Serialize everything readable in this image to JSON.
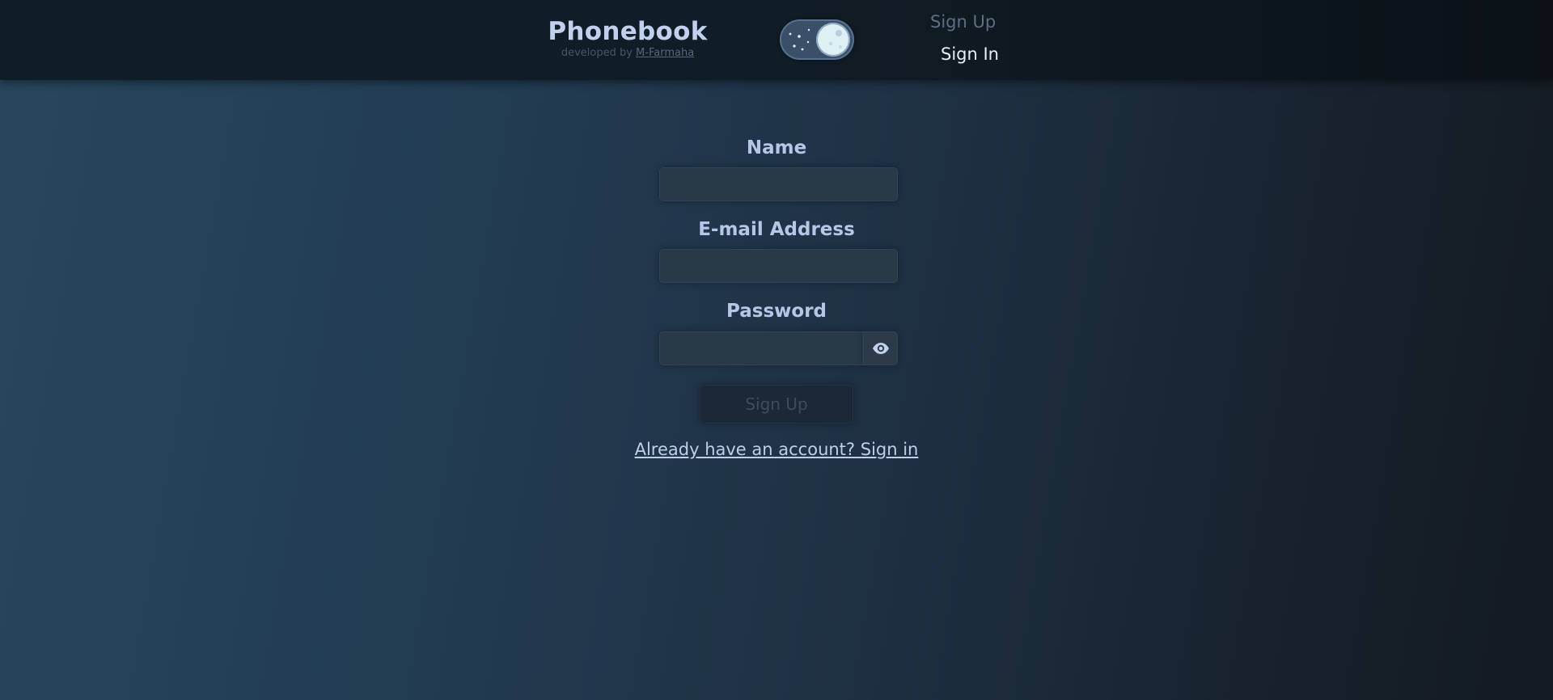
{
  "header": {
    "brand_title": "Phonebook",
    "brand_sub_prefix": "developed by ",
    "brand_sub_link": "M-Farmaha",
    "theme_toggle_icon": "moon-icon",
    "nav": {
      "sign_up": "Sign Up",
      "sign_in": "Sign In"
    }
  },
  "form": {
    "name_label": "Name",
    "name_value": "",
    "email_label": "E-mail Address",
    "email_value": "",
    "password_label": "Password",
    "password_value": "",
    "password_toggle_icon": "eye-icon",
    "submit_label": "Sign Up",
    "signin_link": "Already have an account? Sign in"
  },
  "colors": {
    "accent_text": "#b9c8e6",
    "header_bg": "#0f1d27",
    "disabled_button_text": "#3c4b5e"
  }
}
